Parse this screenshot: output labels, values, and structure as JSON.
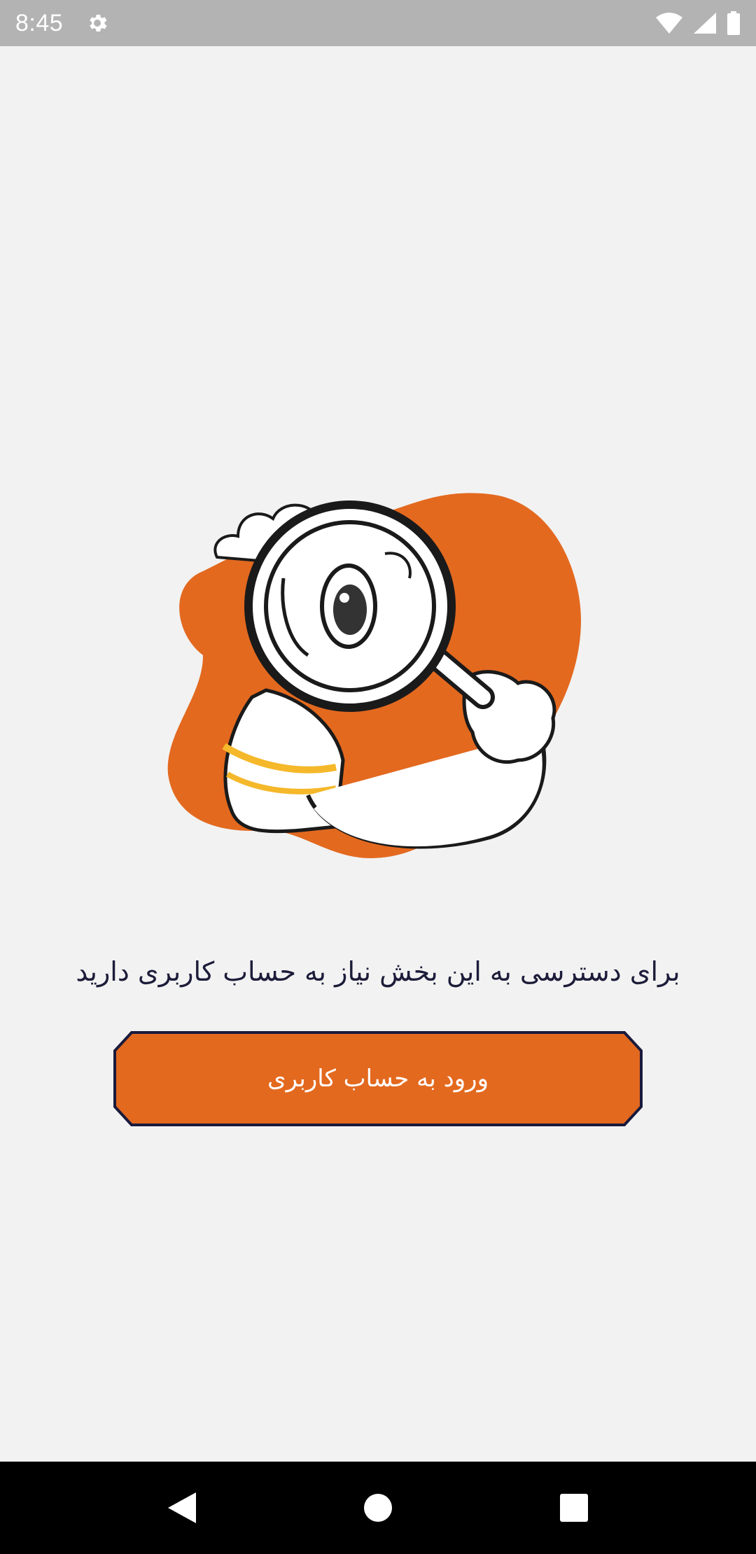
{
  "status_bar": {
    "time": "8:45",
    "icons": [
      "gear-icon",
      "wifi-icon",
      "cellular-signal-icon",
      "battery-icon"
    ]
  },
  "empty_state": {
    "illustration": "character-with-magnifying-glass",
    "message": "برای دسترسی به این بخش نیاز به حساب کاربری دارید",
    "login_button_label": "ورود به حساب کاربری"
  },
  "colors": {
    "accent_orange": "#e3691f",
    "button_border": "#1a1a3d",
    "background": "#f2f2f2",
    "shirt_stripe": "#f5b82a"
  },
  "nav_bar": {
    "icons": [
      "back-icon",
      "home-icon",
      "recents-icon"
    ]
  }
}
